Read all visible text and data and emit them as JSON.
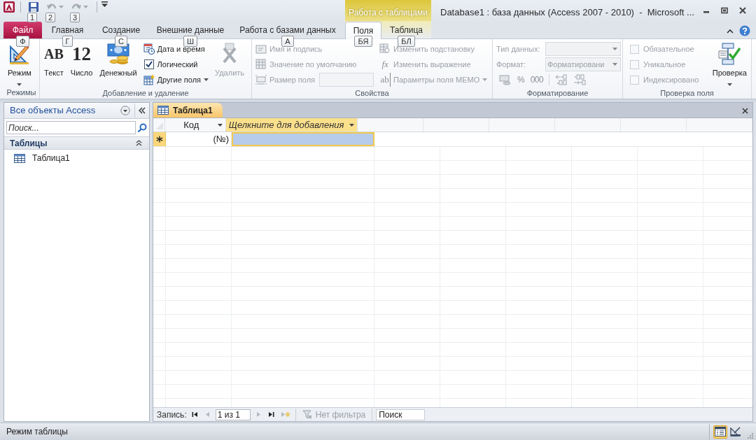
{
  "title_bar": {
    "title": "Database1 : база данных (Access 2007 - 2010)  -  Microsoft ...",
    "context_group": "Работа с таблицами"
  },
  "quick_access": [
    {
      "keytip": "1",
      "disabled": false
    },
    {
      "keytip": "2",
      "disabled": true
    },
    {
      "keytip": "3",
      "disabled": true
    }
  ],
  "tabs": [
    {
      "label": "Файл",
      "keytip": "Ф",
      "kind": "file",
      "selected": false
    },
    {
      "label": "Главная",
      "keytip": "Г",
      "kind": "normal",
      "selected": false
    },
    {
      "label": "Создание",
      "keytip": "С",
      "kind": "normal",
      "selected": false
    },
    {
      "label": "Внешние данные",
      "keytip": "Ш",
      "kind": "normal",
      "selected": false
    },
    {
      "label": "Работа с базами данных",
      "keytip": "А",
      "kind": "normal",
      "selected": false
    },
    {
      "label": "Поля",
      "keytip": "БЯ",
      "kind": "context",
      "selected": true
    },
    {
      "label": "Таблица",
      "keytip": "БЛ",
      "kind": "context",
      "selected": false
    }
  ],
  "ribbon": {
    "groups": [
      {
        "label": "Режимы",
        "items": [
          {
            "kind": "large",
            "label": "Режим",
            "dropdown": true,
            "disabled": false
          }
        ]
      },
      {
        "label": "Добавление и удаление",
        "items": [
          {
            "kind": "large",
            "label": "Текст",
            "glyph": "AB",
            "disabled": false
          },
          {
            "kind": "large",
            "label": "Число",
            "glyph": "12",
            "disabled": false
          },
          {
            "kind": "large",
            "label": "Денежный",
            "disabled": false
          },
          {
            "kind": "stack",
            "items": [
              {
                "kind": "button",
                "label": "Дата и время",
                "disabled": false
              },
              {
                "kind": "button",
                "label": "Логический",
                "disabled": false
              },
              {
                "kind": "button",
                "label": "Другие поля",
                "dropdown": true,
                "disabled": false
              }
            ]
          },
          {
            "kind": "large",
            "label": "Удалить",
            "disabled": true
          }
        ]
      },
      {
        "label": "Свойства",
        "items": [
          {
            "kind": "stack",
            "items": [
              {
                "kind": "button",
                "label": "Имя и подпись",
                "disabled": true
              },
              {
                "kind": "button",
                "label": "Значение по умолчанию",
                "disabled": true
              },
              {
                "kind": "field",
                "label": "Размер поля",
                "disabled": true
              }
            ]
          },
          {
            "kind": "stack",
            "items": [
              {
                "kind": "button",
                "label": "Изменить подстановку",
                "disabled": true
              },
              {
                "kind": "button",
                "label": "Изменить выражение",
                "glyph": "fx",
                "disabled": true
              },
              {
                "kind": "button",
                "label": "Параметры поля MEMO",
                "glyph": "ab",
                "dropdown": true,
                "disabled": true
              }
            ]
          }
        ]
      },
      {
        "label": "Форматирование",
        "items": [
          {
            "kind": "stack",
            "items": [
              {
                "kind": "combo",
                "label": "Тип данных:",
                "disabled": true
              },
              {
                "kind": "combo",
                "label": "Формат:",
                "value": "Форматировани",
                "disabled": true
              },
              {
                "kind": "tools",
                "disabled": true,
                "buttons": [
                  {
                    "kind": "icon"
                  },
                  {
                    "kind": "text",
                    "label": "%"
                  },
                  {
                    "kind": "text",
                    "label": "000"
                  },
                  {
                    "kind": "icon"
                  },
                  {
                    "kind": "icon"
                  }
                ]
              }
            ]
          }
        ]
      },
      {
        "label": "Проверка поля",
        "items": [
          {
            "kind": "stack",
            "items": [
              {
                "kind": "checkbox",
                "label": "Обязательное",
                "checked": false,
                "disabled": true
              },
              {
                "kind": "checkbox",
                "label": "Уникальное",
                "checked": false,
                "disabled": true
              },
              {
                "kind": "checkbox",
                "label": "Индексировано",
                "checked": false,
                "disabled": true
              }
            ]
          },
          {
            "kind": "large",
            "label": "Проверка",
            "dropdown": true,
            "disabled": false
          }
        ]
      }
    ]
  },
  "navigation_pane": {
    "title": "Все объекты Access",
    "search_placeholder": "Поиск...",
    "groups": [
      {
        "label": "Таблицы",
        "expanded": true,
        "items": [
          {
            "label": "Таблица1",
            "selected": false
          }
        ]
      }
    ]
  },
  "document_tabs": [
    {
      "label": "Таблица1",
      "selected": true
    }
  ],
  "datasheet": {
    "columns": [
      {
        "label": "Код",
        "kind": "field",
        "selected": false
      },
      {
        "label": "Щелкните для добавления",
        "kind": "add",
        "selected": true
      }
    ],
    "new_row": {
      "cells": [
        "(№)"
      ]
    }
  },
  "record_nav": {
    "label": "Запись:",
    "position": "1 из 1",
    "buttons": [
      {
        "disabled": false
      },
      {
        "disabled": true
      },
      {
        "disabled": true
      },
      {
        "disabled": false
      },
      {
        "disabled": true
      }
    ],
    "filter": {
      "label": "Нет фильтра",
      "disabled": true
    },
    "search_placeholder": "Поиск"
  },
  "status_bar": {
    "text": "Режим таблицы",
    "views": [
      {
        "selected": true
      },
      {
        "selected": false
      }
    ]
  }
}
